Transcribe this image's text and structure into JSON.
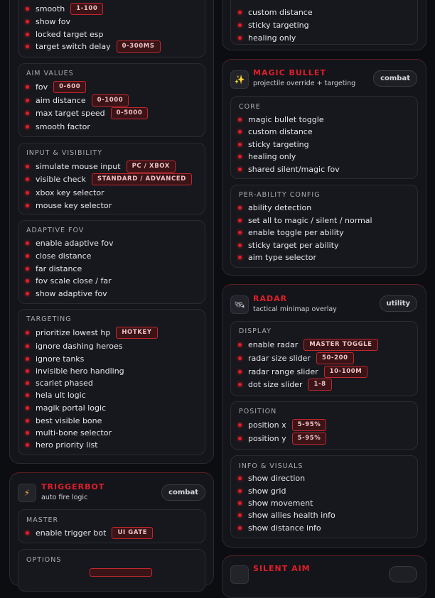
{
  "left": {
    "top_section": {
      "items": [
        {
          "label": "smooth",
          "badge": "1-100"
        },
        {
          "label": "show fov",
          "badge": ""
        },
        {
          "label": "locked target esp",
          "badge": ""
        },
        {
          "label": "target switch delay",
          "badge": "0-300MS"
        }
      ]
    },
    "aim_values": {
      "title": "AIM VALUES",
      "items": [
        {
          "label": "fov",
          "badge": "0-600"
        },
        {
          "label": "aim distance",
          "badge": "0-1000"
        },
        {
          "label": "max target speed",
          "badge": "0-5000"
        },
        {
          "label": "smooth factor",
          "badge": ""
        }
      ]
    },
    "input_visibility": {
      "title": "INPUT & VISIBILITY",
      "items": [
        {
          "label": "simulate mouse input",
          "badge": "PC / XBOX"
        },
        {
          "label": "visible check",
          "badge": "STANDARD / ADVANCED"
        },
        {
          "label": "xbox key selector",
          "badge": ""
        },
        {
          "label": "mouse key selector",
          "badge": ""
        }
      ]
    },
    "adaptive_fov": {
      "title": "ADAPTIVE FOV",
      "items": [
        {
          "label": "enable adaptive fov"
        },
        {
          "label": "close distance"
        },
        {
          "label": "far distance"
        },
        {
          "label": "fov scale close / far"
        },
        {
          "label": "show adaptive fov"
        }
      ]
    },
    "targeting": {
      "title": "TARGETING",
      "items": [
        {
          "label": "prioritize lowest hp",
          "badge": "HOTKEY"
        },
        {
          "label": "ignore dashing heroes",
          "badge": ""
        },
        {
          "label": "ignore tanks",
          "badge": ""
        },
        {
          "label": "invisible hero handling",
          "badge": ""
        },
        {
          "label": "scarlet phased",
          "badge": ""
        },
        {
          "label": "hela ult logic",
          "badge": ""
        },
        {
          "label": "magik portal logic",
          "badge": ""
        },
        {
          "label": "best visible bone",
          "badge": ""
        },
        {
          "label": "multi-bone selector",
          "badge": ""
        },
        {
          "label": "hero priority list",
          "badge": ""
        }
      ]
    },
    "triggerbot": {
      "icon": "lightning-icon",
      "title": "TRIGGERBOT",
      "subtitle": "auto fire logic",
      "tag": "combat",
      "master": {
        "title": "MASTER",
        "items": [
          {
            "label": "enable trigger bot",
            "badge": "UI GATE"
          }
        ]
      },
      "options": {
        "title": "OPTIONS"
      }
    }
  },
  "right": {
    "top_section": {
      "items": [
        {
          "label": "custom distance"
        },
        {
          "label": "sticky targeting"
        },
        {
          "label": "healing only"
        }
      ]
    },
    "magic_bullet": {
      "icon": "sparkle-icon",
      "title": "MAGIC BULLET",
      "subtitle": "projectile override + targeting",
      "tag": "combat",
      "core": {
        "title": "CORE",
        "items": [
          {
            "label": "magic bullet toggle"
          },
          {
            "label": "custom distance"
          },
          {
            "label": "sticky targeting"
          },
          {
            "label": "healing only"
          },
          {
            "label": "shared silent/magic fov"
          }
        ]
      },
      "per_ability": {
        "title": "PER-ABILITY CONFIG",
        "items": [
          {
            "label": "ability detection"
          },
          {
            "label": "set all to magic / silent / normal"
          },
          {
            "label": "enable toggle per ability"
          },
          {
            "label": "sticky target per ability"
          },
          {
            "label": "aim type selector"
          }
        ]
      }
    },
    "radar": {
      "icon": "satellite-icon",
      "title": "RADAR",
      "subtitle": "tactical minimap overlay",
      "tag": "utility",
      "display": {
        "title": "DISPLAY",
        "items": [
          {
            "label": "enable radar",
            "badge": "MASTER TOGGLE"
          },
          {
            "label": "radar size slider",
            "badge": "50-200"
          },
          {
            "label": "radar range slider",
            "badge": "10-100M"
          },
          {
            "label": "dot size slider",
            "badge": "1-8"
          }
        ]
      },
      "position": {
        "title": "POSITION",
        "items": [
          {
            "label": "position x",
            "badge": "5-95%"
          },
          {
            "label": "position y",
            "badge": "5-95%"
          }
        ]
      },
      "info": {
        "title": "INFO & VISUALS",
        "items": [
          {
            "label": "show direction"
          },
          {
            "label": "show grid"
          },
          {
            "label": "show movement"
          },
          {
            "label": "show allies health info"
          },
          {
            "label": "show distance info"
          }
        ]
      }
    },
    "silent_aim": {
      "title": "SILENT AIM"
    }
  }
}
